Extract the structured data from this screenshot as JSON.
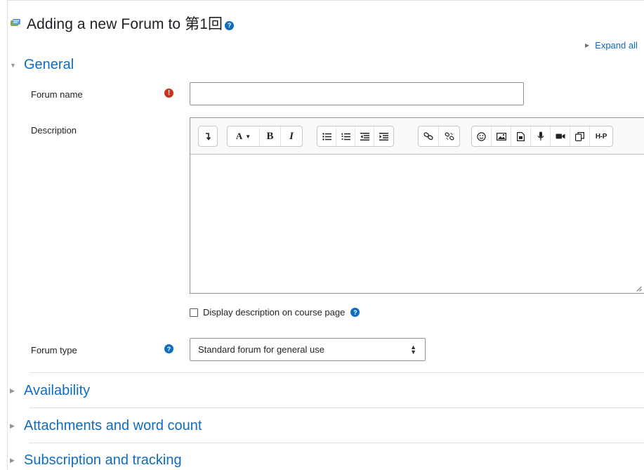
{
  "page": {
    "title": "Adding a new Forum to 第1回",
    "expand_all": "Expand all"
  },
  "sections": {
    "general": "General",
    "availability": "Availability",
    "attachments": "Attachments and word count",
    "subscription": "Subscription and tracking"
  },
  "form": {
    "forum_name_label": "Forum name",
    "forum_name_value": "",
    "description_label": "Description",
    "display_description_label": "Display description on course page",
    "display_description_checked": false,
    "forum_type_label": "Forum type",
    "forum_type_value": "Standard forum for general use"
  },
  "toolbar": {
    "groups": [
      [
        "collapse"
      ],
      [
        "paragraph-styles",
        "bold",
        "italic"
      ],
      [
        "unordered-list",
        "ordered-list",
        "outdent",
        "indent"
      ],
      [
        "link",
        "unlink"
      ],
      [
        "emoji",
        "image",
        "media",
        "record-audio",
        "record-video",
        "manage-files",
        "h5p"
      ]
    ],
    "bold_label": "B",
    "italic_label": "I",
    "h5p_label": "H-P",
    "styles_label": "A"
  },
  "colors": {
    "link": "#0f6cbf",
    "required": "#ca3120",
    "border": "#8f959e"
  }
}
